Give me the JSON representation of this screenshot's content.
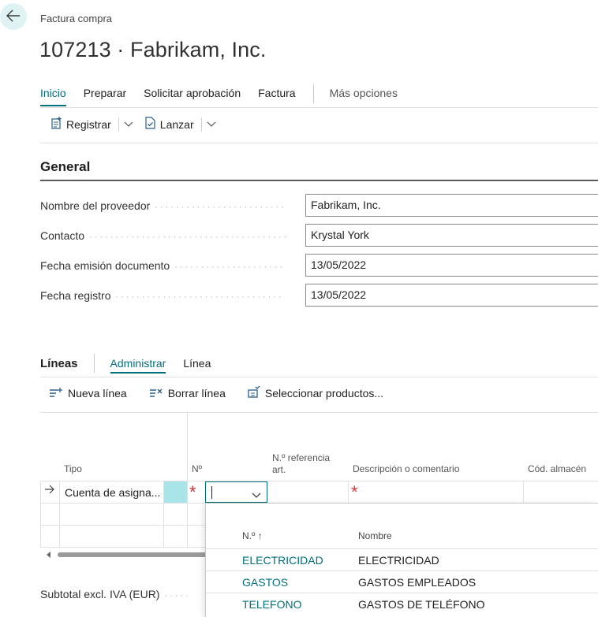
{
  "header": {
    "caption": "Factura compra",
    "title": "107213 · Fabrikam, Inc."
  },
  "tabs": [
    {
      "label": "Inicio",
      "active": true
    },
    {
      "label": "Preparar"
    },
    {
      "label": "Solicitar aprobación"
    },
    {
      "label": "Factura"
    },
    {
      "label": "Más opciones"
    }
  ],
  "actions": {
    "post": "Registrar",
    "release": "Lanzar"
  },
  "general": {
    "title": "General",
    "fields": [
      {
        "label": "Nombre del proveedor",
        "value": "Fabrikam, Inc."
      },
      {
        "label": "Contacto",
        "value": "Krystal York"
      },
      {
        "label": "Fecha emisión documento",
        "value": "13/05/2022"
      },
      {
        "label": "Fecha registro",
        "value": "13/05/2022"
      }
    ]
  },
  "lines": {
    "title": "Líneas",
    "tabs": [
      "Administrar",
      "Línea"
    ],
    "actions": [
      "Nueva línea",
      "Borrar línea",
      "Seleccionar productos..."
    ],
    "columns": {
      "type": "Tipo",
      "no": "Nº",
      "ref_line1": "N.º referencia",
      "ref_line2": "art.",
      "description": "Descripción o comentario",
      "location": "Cód. almacén"
    },
    "row": {
      "type": "Cuenta de asigna...",
      "required_mark": "*"
    }
  },
  "lookup": {
    "col_no": "N.º ↑",
    "col_name": "Nombre",
    "rows": [
      {
        "no": "ELECTRICIDAD",
        "name": "ELECTRICIDAD"
      },
      {
        "no": "GASTOS",
        "name": "GASTOS EMPLEADOS"
      },
      {
        "no": "TELEFONO",
        "name": "GASTOS DE TELÉFONO"
      }
    ]
  },
  "totals": {
    "subtotal_label": "Subtotal excl. IVA (EUR)"
  },
  "colors": {
    "accent": "#00707d",
    "required": "#d13438",
    "selected_cell": "#a8e4e8"
  }
}
